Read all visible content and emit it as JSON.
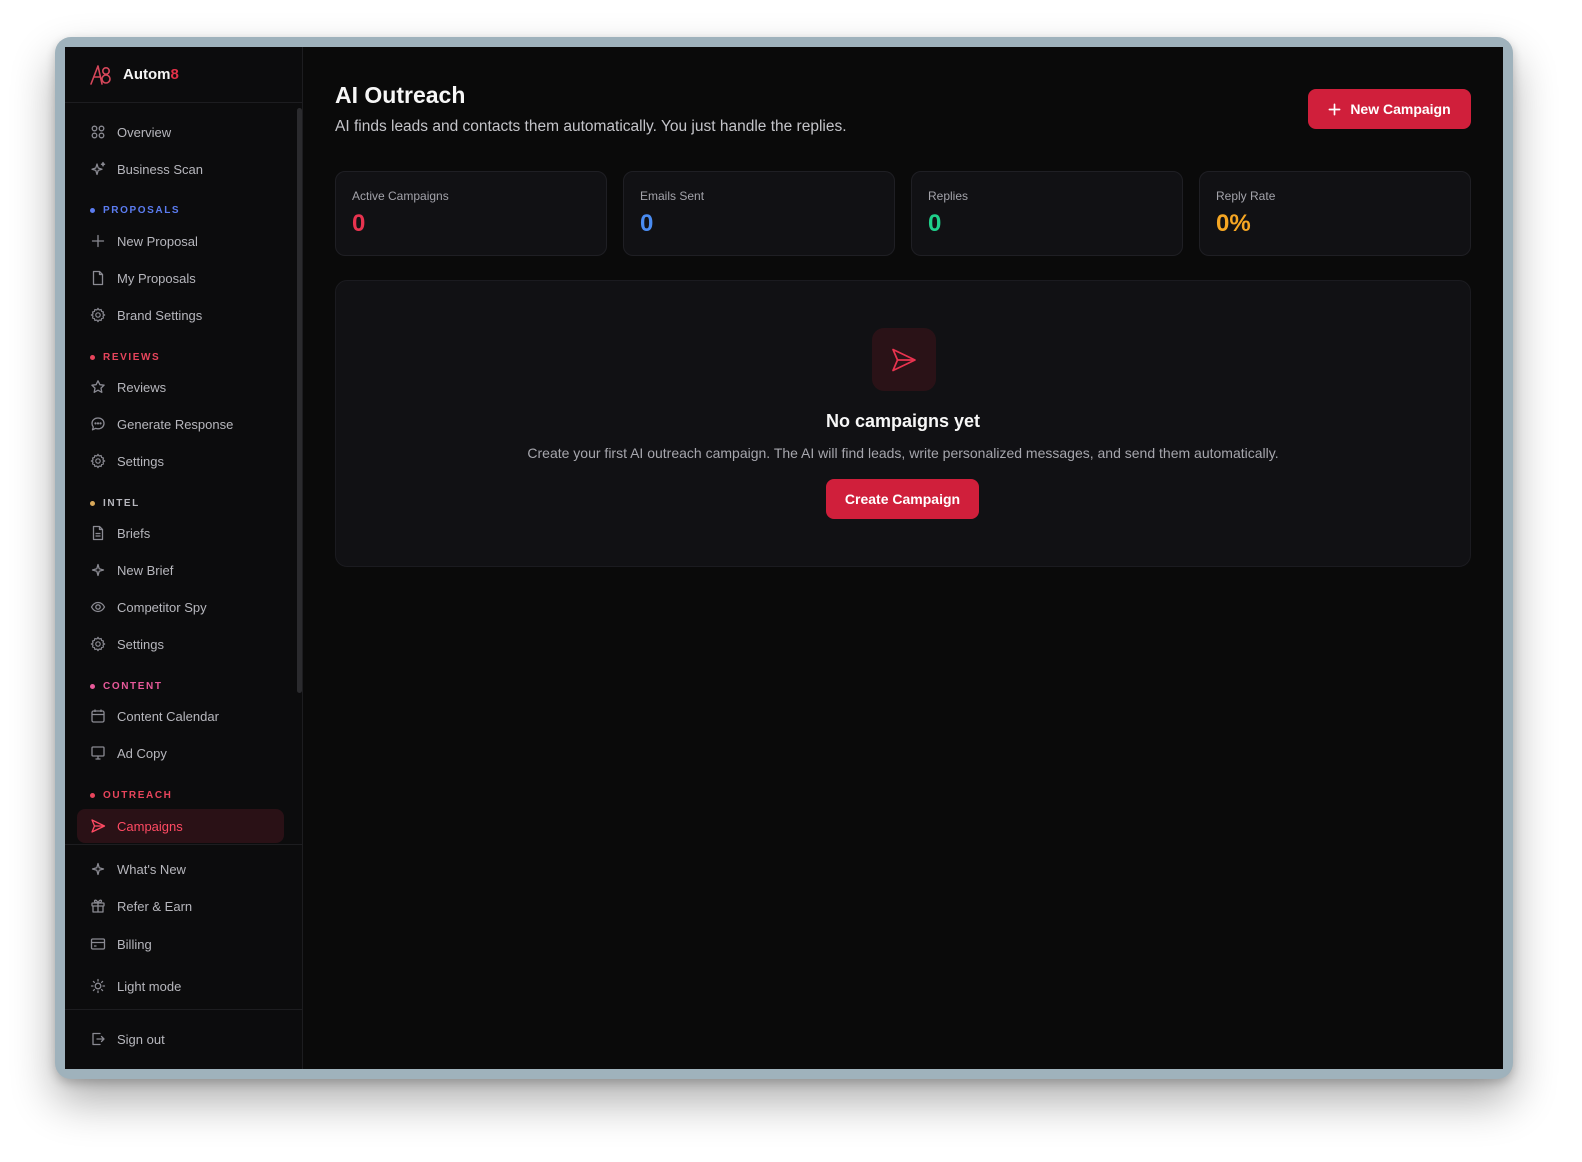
{
  "brand": {
    "name": "Autom",
    "accent": "8",
    "color": "#e23148"
  },
  "sidebar": {
    "items": [
      {
        "key": "overview",
        "label": "Overview",
        "icon": "grid-icon"
      },
      {
        "key": "business-scan",
        "label": "Business Scan",
        "icon": "sparkle-icon"
      },
      {
        "key": "new-proposal",
        "label": "New Proposal",
        "icon": "plus-icon"
      },
      {
        "key": "my-proposals",
        "label": "My Proposals",
        "icon": "file-icon"
      },
      {
        "key": "brand-settings",
        "label": "Brand Settings",
        "icon": "gear-icon"
      },
      {
        "key": "reviews",
        "label": "Reviews",
        "icon": "star-icon"
      },
      {
        "key": "generate-response",
        "label": "Generate Response",
        "icon": "chat-bubble-icon"
      },
      {
        "key": "reviews-settings",
        "label": "Settings",
        "icon": "gear-icon"
      },
      {
        "key": "briefs",
        "label": "Briefs",
        "icon": "file-text-icon"
      },
      {
        "key": "new-brief",
        "label": "New Brief",
        "icon": "sparkle-icon"
      },
      {
        "key": "competitor-spy",
        "label": "Competitor Spy",
        "icon": "eye-icon"
      },
      {
        "key": "intel-settings",
        "label": "Settings",
        "icon": "gear-icon"
      },
      {
        "key": "content-calendar",
        "label": "Content Calendar",
        "icon": "calendar-icon"
      },
      {
        "key": "ad-copy",
        "label": "Ad Copy",
        "icon": "monitor-icon"
      },
      {
        "key": "campaigns",
        "label": "Campaigns",
        "icon": "send-icon",
        "active": true
      }
    ],
    "sections": [
      {
        "key": "proposals",
        "label": "PROPOSALS",
        "color": "#5b7cf0"
      },
      {
        "key": "reviews",
        "label": "REVIEWS",
        "color": "#e8455c"
      },
      {
        "key": "intel",
        "label": "INTEL",
        "color": "#b7b7bd"
      },
      {
        "key": "content",
        "label": "CONTENT",
        "color": "#e85a9a"
      },
      {
        "key": "outreach",
        "label": "OUTREACH",
        "color": "#e8455c"
      }
    ],
    "footer_items": [
      {
        "key": "whats-new",
        "label": "What's New",
        "icon": "sparkle-icon"
      },
      {
        "key": "refer-earn",
        "label": "Refer & Earn",
        "icon": "gift-icon"
      },
      {
        "key": "billing",
        "label": "Billing",
        "icon": "credit-card-icon"
      },
      {
        "key": "light-mode",
        "label": "Light mode",
        "icon": "sun-icon"
      },
      {
        "key": "sign-out",
        "label": "Sign out",
        "icon": "sign-out-icon"
      }
    ]
  },
  "header": {
    "title": "AI Outreach",
    "subtitle": "AI finds leads and contacts them automatically. You just handle the replies.",
    "new_campaign_label": "New Campaign"
  },
  "stats": [
    {
      "label": "Active Campaigns",
      "value": "0",
      "color": "#e8334f"
    },
    {
      "label": "Emails Sent",
      "value": "0",
      "color": "#4a8cf2"
    },
    {
      "label": "Replies",
      "value": "0",
      "color": "#1fcf8a"
    },
    {
      "label": "Reply Rate",
      "value": "0%",
      "color": "#f5a623"
    }
  ],
  "empty_state": {
    "icon": "send-icon",
    "title": "No campaigns yet",
    "description": "Create your first AI outreach campaign. The AI will find leads, write personalized messages, and send them automatically.",
    "cta_label": "Create Campaign"
  }
}
